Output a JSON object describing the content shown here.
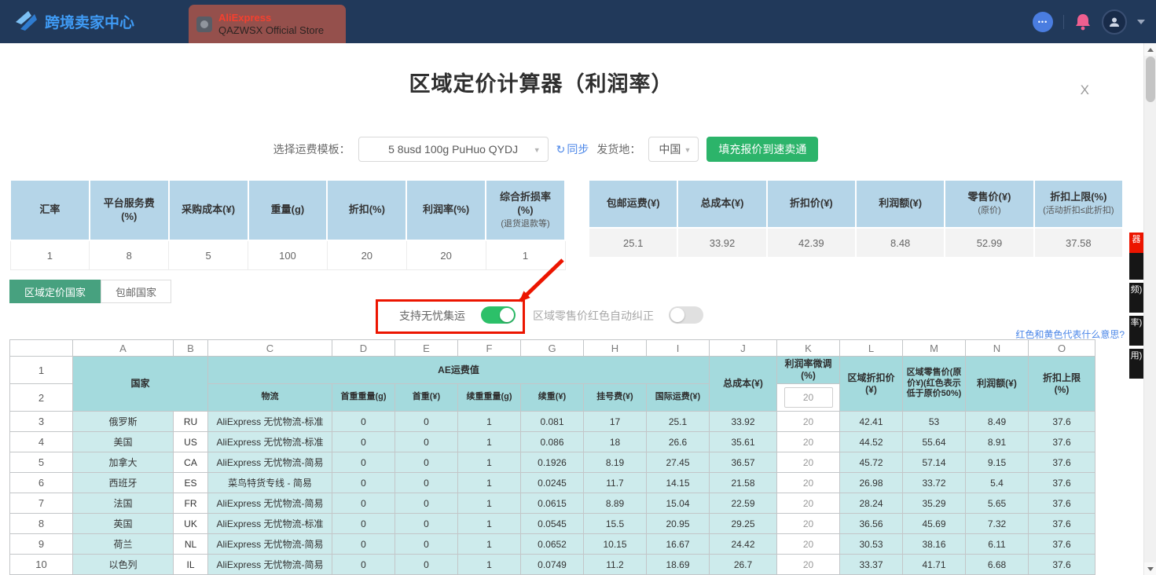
{
  "colors": {
    "topbar_navy": "#21395A",
    "brand_blue": "#3F9BF5",
    "store_tab_red": "#95504C",
    "aliexpress_red": "#F4402F",
    "accent_green": "#2CB46A",
    "tab_green": "#47A17F",
    "header_blue": "#B5D5E8",
    "sheet_header_teal": "#A4DADD",
    "sheet_cell_teal": "#CDEBEC",
    "annotation_red": "#EC1500",
    "link_blue": "#4C87E8",
    "toggle_on_green": "#2CC069"
  },
  "icons": {
    "caret": "▼",
    "sync": "↻",
    "chat_dots": "•••"
  },
  "topbar": {
    "brand": "跨境卖家中心",
    "store_tab": {
      "line1": "AliExpress",
      "line2": "QAZWSX Official Store"
    }
  },
  "modal": {
    "title": "区域定价计算器（利润率）",
    "close": "X",
    "toolbar": {
      "template_label": "选择运费模板：",
      "template_value": "5 8usd 100g PuHuo QYDJ",
      "sync": "同步",
      "ship_from_label": "发货地：",
      "ship_from_value": "中国",
      "fill_button": "填充报价到速卖通"
    },
    "params_table": {
      "headers": [
        {
          "title": "汇率",
          "note": ""
        },
        {
          "title": "平台服务费(%)",
          "note": ""
        },
        {
          "title": "采购成本(¥)",
          "note": ""
        },
        {
          "title": "重量(g)",
          "note": ""
        },
        {
          "title": "折扣(%)",
          "note": ""
        },
        {
          "title": "利润率(%)",
          "note": ""
        },
        {
          "title": "综合折损率(%)",
          "note": "(退货退款等)"
        }
      ],
      "values": [
        "1",
        "8",
        "5",
        "100",
        "20",
        "20",
        "1"
      ]
    },
    "results_table": {
      "headers": [
        {
          "title": "包邮运费(¥)",
          "note": ""
        },
        {
          "title": "总成本(¥)",
          "note": ""
        },
        {
          "title": "折扣价(¥)",
          "note": ""
        },
        {
          "title": "利润额(¥)",
          "note": ""
        },
        {
          "title": "零售价(¥)",
          "note": "(原价)"
        },
        {
          "title": "折扣上限(%)",
          "note": "(活动折扣≤此折扣)"
        }
      ],
      "values": [
        "25.1",
        "33.92",
        "42.39",
        "8.48",
        "52.99",
        "37.58"
      ]
    },
    "tabs": [
      {
        "label": "区域定价国家",
        "active": true
      },
      {
        "label": "包邮国家",
        "active": false
      }
    ],
    "toggles": [
      {
        "label": "支持无忧集运",
        "on": true
      },
      {
        "label": "区域零售价红色自动纠正",
        "on": false
      }
    ],
    "hint_link": "红色和黄色代表什么意思?"
  },
  "sheet": {
    "col_letters": [
      "A",
      "B",
      "C",
      "D",
      "E",
      "F",
      "G",
      "H",
      "I",
      "J",
      "K",
      "L",
      "M",
      "N",
      "O"
    ],
    "header_row_numbers": [
      "1",
      "2"
    ],
    "header": {
      "country": "国家",
      "ae_group": "AE运费值",
      "logistics": "物流",
      "first_weight": "首重重量(g)",
      "first_fee": "首重(¥)",
      "cont_weight": "续重重量(g)",
      "cont_fee": "续重(¥)",
      "reg_fee": "挂号费(¥)",
      "intl_fee": "国际运费(¥)",
      "total_cost": "总成本(¥)",
      "margin_adjust": "利润率微调(%)",
      "margin_adjust_value": "20",
      "zone_discount": "区域折扣价(¥)",
      "zone_retail": "区域零售价(原价¥)(红色表示低于原价50%)",
      "profit": "利润额(¥)",
      "discount_cap": "折扣上限(%)"
    },
    "rows": [
      {
        "num": "3",
        "cells": [
          "俄罗斯",
          "RU",
          "AliExpress 无忧物流-标准",
          "0",
          "0",
          "1",
          "0.081",
          "17",
          "25.1",
          "33.92",
          "20",
          "42.41",
          "53",
          "8.49",
          "37.6"
        ]
      },
      {
        "num": "4",
        "cells": [
          "美国",
          "US",
          "AliExpress 无忧物流-标准",
          "0",
          "0",
          "1",
          "0.086",
          "18",
          "26.6",
          "35.61",
          "20",
          "44.52",
          "55.64",
          "8.91",
          "37.6"
        ]
      },
      {
        "num": "5",
        "cells": [
          "加拿大",
          "CA",
          "AliExpress 无忧物流-简易",
          "0",
          "0",
          "1",
          "0.1926",
          "8.19",
          "27.45",
          "36.57",
          "20",
          "45.72",
          "57.14",
          "9.15",
          "37.6"
        ]
      },
      {
        "num": "6",
        "cells": [
          "西班牙",
          "ES",
          "菜鸟特货专线 - 简易",
          "0",
          "0",
          "1",
          "0.0245",
          "11.7",
          "14.15",
          "21.58",
          "20",
          "26.98",
          "33.72",
          "5.4",
          "37.6"
        ]
      },
      {
        "num": "7",
        "cells": [
          "法国",
          "FR",
          "AliExpress 无忧物流-简易",
          "0",
          "0",
          "1",
          "0.0615",
          "8.89",
          "15.04",
          "22.59",
          "20",
          "28.24",
          "35.29",
          "5.65",
          "37.6"
        ]
      },
      {
        "num": "8",
        "cells": [
          "英国",
          "UK",
          "AliExpress 无忧物流-标准",
          "0",
          "0",
          "1",
          "0.0545",
          "15.5",
          "20.95",
          "29.25",
          "20",
          "36.56",
          "45.69",
          "7.32",
          "37.6"
        ]
      },
      {
        "num": "9",
        "cells": [
          "荷兰",
          "NL",
          "AliExpress 无忧物流-简易",
          "0",
          "0",
          "1",
          "0.0652",
          "10.15",
          "16.67",
          "24.42",
          "20",
          "30.53",
          "38.16",
          "6.11",
          "37.6"
        ]
      },
      {
        "num": "10",
        "cells": [
          "以色列",
          "IL",
          "AliExpress 无忧物流-简易",
          "0",
          "0",
          "1",
          "0.0749",
          "11.2",
          "18.69",
          "26.7",
          "20",
          "33.37",
          "41.71",
          "6.68",
          "37.6"
        ]
      }
    ]
  },
  "side_widgets": [
    {
      "text": "器",
      "accent": true
    },
    {
      "text": "",
      "accent": false
    },
    {
      "text": "频)",
      "accent": false
    },
    {
      "text": "率)",
      "accent": false
    },
    {
      "text": "用)",
      "accent": false
    }
  ]
}
